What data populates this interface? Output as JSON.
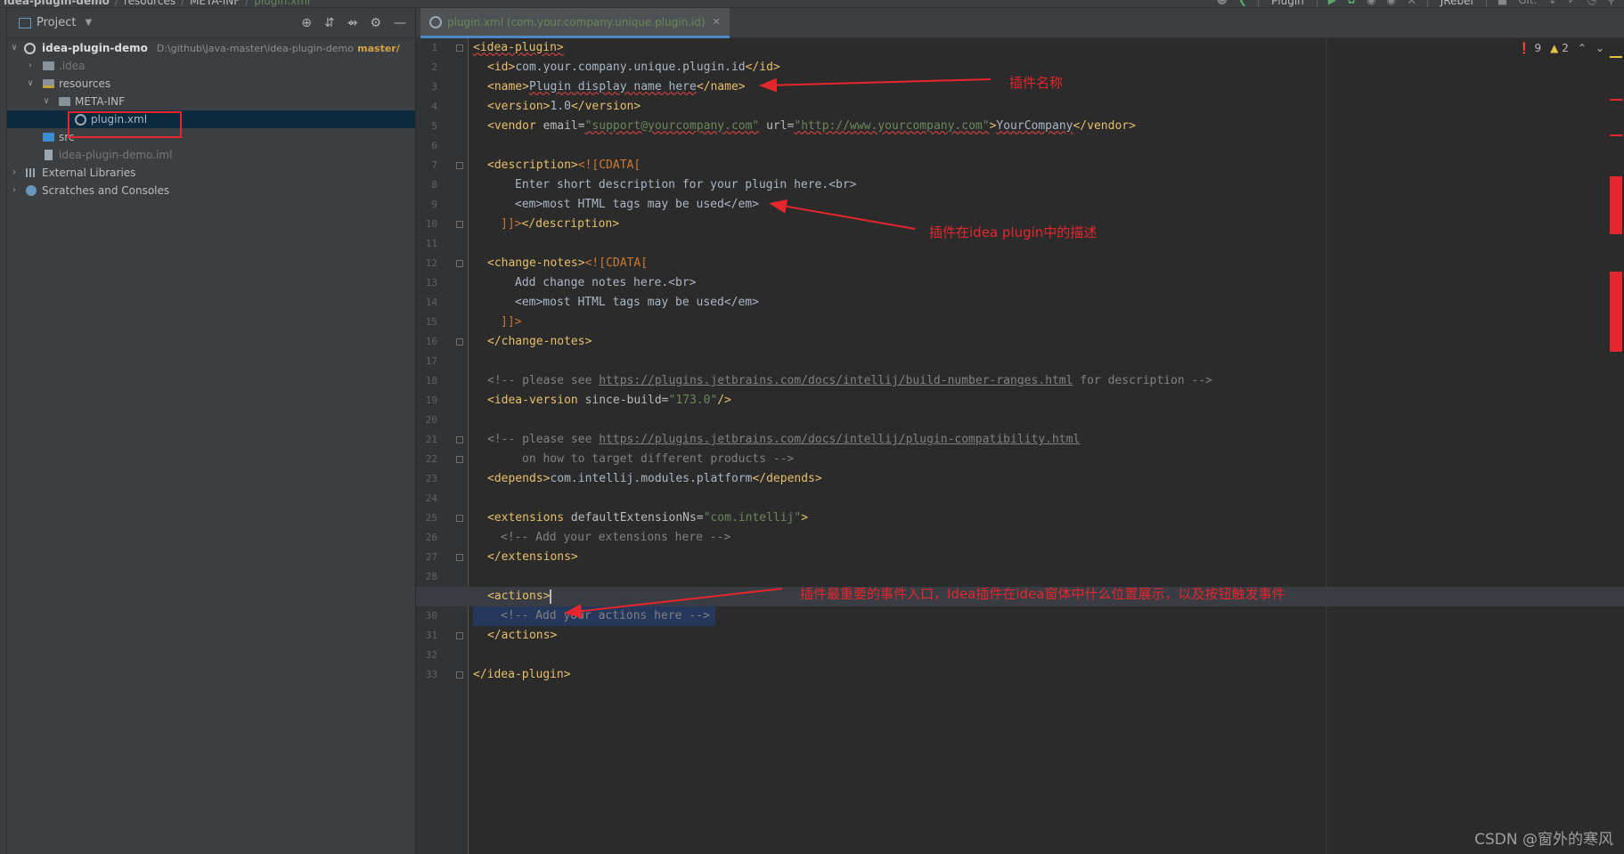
{
  "top_bar": {
    "breadcrumbs": [
      "idea-plugin-demo",
      "resources",
      "META-INF",
      "plugin.xml"
    ],
    "run_config": "Plugin",
    "jrebel": "JRebel",
    "git": "Git:"
  },
  "project_panel": {
    "title": "Project",
    "tree": [
      {
        "label": "idea-plugin-demo",
        "path": "D:\\github\\java-master\\idea-plugin-demo",
        "branch": "master/"
      },
      {
        "label": ".idea"
      },
      {
        "label": "resources"
      },
      {
        "label": "META-INF"
      },
      {
        "label": "plugin.xml"
      },
      {
        "label": "src"
      },
      {
        "label": "idea-plugin-demo.iml"
      },
      {
        "label": "External Libraries"
      },
      {
        "label": "Scratches and Consoles"
      }
    ]
  },
  "editor": {
    "tab_label": "plugin.xml (com.your.company.unique.plugin.id)",
    "error_count": "9",
    "warning_count": "2",
    "line_numbers": [
      "1",
      "2",
      "3",
      "4",
      "5",
      "6",
      "7",
      "8",
      "9",
      "10",
      "11",
      "12",
      "13",
      "14",
      "15",
      "16",
      "17",
      "18",
      "19",
      "20",
      "21",
      "22",
      "23",
      "24",
      "25",
      "26",
      "27",
      "28",
      "29",
      "30",
      "31",
      "32",
      "33"
    ],
    "lines": {
      "l1": "<idea-plugin>",
      "l2_open": "<id>",
      "l2_text": "com.your.company.unique.plugin.id",
      "l2_close": "</id>",
      "l3_open": "<name>",
      "l3_text": "Plugin display name here",
      "l3_close": "</name>",
      "l4_open": "<version>",
      "l4_text": "1.0",
      "l4_close": "</version>",
      "l5_open": "<vendor",
      "l5_attr1": " email=",
      "l5_val1": "\"support@yourcompany.com\"",
      "l5_attr2": " url=",
      "l5_val2": "\"http://www.yourcompany.com\"",
      "l5_gt": ">",
      "l5_text": "YourCompany",
      "l5_close": "</vendor>",
      "l7_open": "<description>",
      "l7_cdata": "<![CDATA[",
      "l8": "Enter short description for your plugin here.<br>",
      "l9": "<em>most HTML tags may be used</em>",
      "l10_cdata": "]]>",
      "l10_close": "</description>",
      "l12_open": "<change-notes>",
      "l12_cdata": "<![CDATA[",
      "l13": "Add change notes here.<br>",
      "l14": "<em>most HTML tags may be used</em>",
      "l15_cdata": "]]>",
      "l16": "</change-notes>",
      "l18_a": "<!-- please see ",
      "l18_link": "https://plugins.jetbrains.com/docs/intellij/build-number-ranges.html",
      "l18_b": " for description -->",
      "l19_open": "<idea-version",
      "l19_attr": " since-build=",
      "l19_val": "\"173.0\"",
      "l19_close": "/>",
      "l21_a": "<!-- please see ",
      "l21_link": "https://plugins.jetbrains.com/docs/intellij/plugin-compatibility.html",
      "l22": "on how to target different products -->",
      "l23_open": "<depends>",
      "l23_text": "com.intellij.modules.platform",
      "l23_close": "</depends>",
      "l25_open": "<extensions",
      "l25_attr": " defaultExtensionNs=",
      "l25_val": "\"com.intellij\"",
      "l25_gt": ">",
      "l26": "<!-- Add your extensions here -->",
      "l27": "</extensions>",
      "l29": "<actions>",
      "l30": "<!-- Add your actions here -->",
      "l31": "</actions>",
      "l33": "</idea-plugin>"
    }
  },
  "annotations": {
    "name_note": "插件名称",
    "description_note": "插件在idea plugin中的描述",
    "actions_note": "插件最重要的事件入口，Idea插件在idea窗体中什么位置展示，以及按钮触发事件"
  },
  "watermark": "CSDN @窗外的寒风",
  "colors": {
    "annotation_red": "#e5262c",
    "tag_yellow": "#e8bf6a",
    "string_green": "#6a8759",
    "comment_gray": "#808080"
  }
}
